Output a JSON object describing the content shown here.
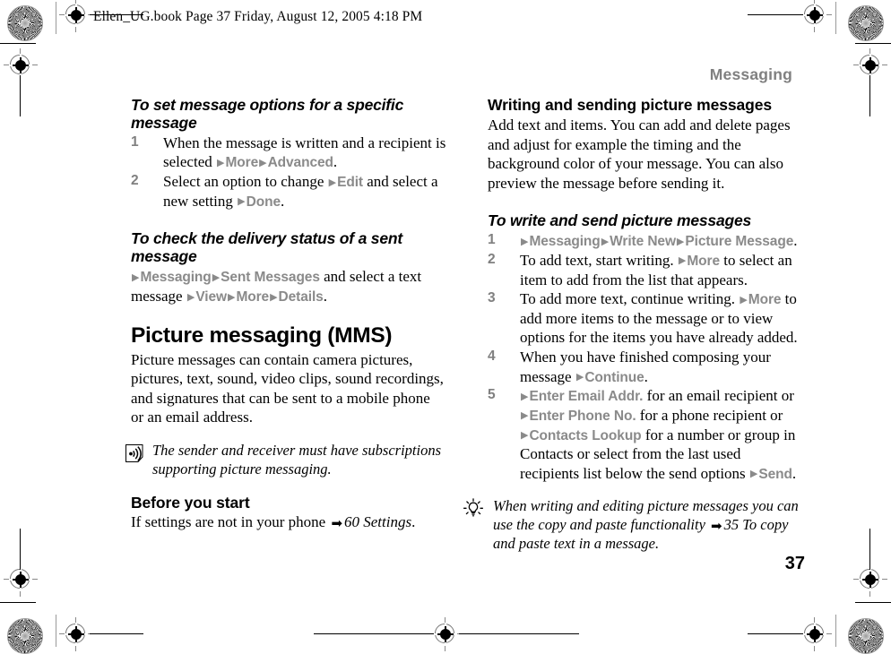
{
  "page": {
    "filestamp": "Ellen_UG.book  Page 37  Friday, August 12, 2005  4:18 PM",
    "running_head": "Messaging",
    "folio": "37",
    "arrow_glyph": "▶",
    "xref_arrow_glyph": "➡",
    "ui_ref_color": "#8a8a8a",
    "running_head_color": "#808080",
    "step_number_color": "#808080",
    "body_color": "#000000",
    "background_color": "#ffffff"
  },
  "left_column": {
    "proc1": {
      "heading": "To set message options for a specific message",
      "steps": [
        {
          "num": "1",
          "parts": [
            {
              "t": "text",
              "v": "When the message is written and a recipient is selected "
            },
            {
              "t": "arrow"
            },
            {
              "t": "ui",
              "v": "More"
            },
            {
              "t": "arrow"
            },
            {
              "t": "ui",
              "v": "Advanced"
            },
            {
              "t": "text",
              "v": "."
            }
          ]
        },
        {
          "num": "2",
          "parts": [
            {
              "t": "text",
              "v": "Select an option to change "
            },
            {
              "t": "arrow"
            },
            {
              "t": "ui",
              "v": "Edit"
            },
            {
              "t": "text",
              "v": " and select a new setting "
            },
            {
              "t": "arrow"
            },
            {
              "t": "ui",
              "v": "Done"
            },
            {
              "t": "text",
              "v": "."
            }
          ]
        }
      ]
    },
    "proc2": {
      "heading": "To check the delivery status of a sent message",
      "body_parts": [
        {
          "t": "arrow"
        },
        {
          "t": "ui",
          "v": "Messaging"
        },
        {
          "t": "arrow"
        },
        {
          "t": "ui",
          "v": "Sent Messages"
        },
        {
          "t": "text",
          "v": " and select a text message  "
        },
        {
          "t": "arrow"
        },
        {
          "t": "ui",
          "v": "View"
        },
        {
          "t": "arrow"
        },
        {
          "t": "ui",
          "v": "More"
        },
        {
          "t": "arrow"
        },
        {
          "t": "ui",
          "v": "Details"
        },
        {
          "t": "text",
          "v": "."
        }
      ]
    },
    "chapter_heading": "Picture messaging (MMS)",
    "chapter_body": "Picture messages can contain camera pictures, pictures, text, sound, video clips, sound recordings, and signatures that can be sent to a mobile phone or an email address.",
    "note": {
      "icon": "broadcast-waves-icon",
      "text": "The sender and receiver must have subscriptions supporting picture messaging."
    },
    "sub_heading": "Before you start",
    "sub_body_parts": [
      {
        "t": "text",
        "v": "If settings are not in your phone "
      },
      {
        "t": "xref_arrow"
      },
      {
        "t": "xref",
        "v": "60 Settings"
      },
      {
        "t": "text",
        "v": "."
      }
    ]
  },
  "right_column": {
    "sub_heading": "Writing and sending picture messages",
    "sub_body": "Add text and items. You can add and delete pages and adjust for example the timing and the background color of your message. You can also preview the message before sending it.",
    "proc": {
      "heading": "To write and send picture messages",
      "steps": [
        {
          "num": "1",
          "parts": [
            {
              "t": "arrow"
            },
            {
              "t": "ui",
              "v": "Messaging"
            },
            {
              "t": "arrow"
            },
            {
              "t": "ui",
              "v": "Write New"
            },
            {
              "t": "arrow"
            },
            {
              "t": "ui",
              "v": "Picture Message"
            },
            {
              "t": "text",
              "v": "."
            }
          ]
        },
        {
          "num": "2",
          "parts": [
            {
              "t": "text",
              "v": "To add text, start writing. "
            },
            {
              "t": "arrow"
            },
            {
              "t": "ui",
              "v": "More"
            },
            {
              "t": "text",
              "v": " to select an item to add from the list that appears."
            }
          ]
        },
        {
          "num": "3",
          "parts": [
            {
              "t": "text",
              "v": "To add more text, continue writing. "
            },
            {
              "t": "arrow"
            },
            {
              "t": "ui",
              "v": "More"
            },
            {
              "t": "text",
              "v": " to add more items to the message or to view options for the items you have already added."
            }
          ]
        },
        {
          "num": "4",
          "parts": [
            {
              "t": "text",
              "v": "When you have finished composing your message "
            },
            {
              "t": "arrow"
            },
            {
              "t": "ui",
              "v": "Continue"
            },
            {
              "t": "text",
              "v": "."
            }
          ]
        },
        {
          "num": "5",
          "parts": [
            {
              "t": "arrow"
            },
            {
              "t": "ui",
              "v": "Enter Email Addr."
            },
            {
              "t": "text",
              "v": " for an email recipient or "
            },
            {
              "t": "arrow"
            },
            {
              "t": "ui",
              "v": "Enter Phone No."
            },
            {
              "t": "text",
              "v": " for a phone recipient or "
            },
            {
              "t": "arrow"
            },
            {
              "t": "ui",
              "v": "Contacts Lookup"
            },
            {
              "t": "text",
              "v": " for a number or group in Contacts or select from the last used recipients list below the send options "
            },
            {
              "t": "arrow"
            },
            {
              "t": "ui",
              "v": "Send"
            },
            {
              "t": "text",
              "v": "."
            }
          ]
        }
      ]
    },
    "tip": {
      "icon": "lightbulb-tip-icon",
      "parts": [
        {
          "t": "text",
          "v": "When writing and editing picture messages you can use the copy and paste functionality "
        },
        {
          "t": "xref_arrow"
        },
        {
          "t": "xref",
          "v": "35 To copy and paste text in a message"
        },
        {
          "t": "text",
          "v": "."
        }
      ]
    }
  }
}
